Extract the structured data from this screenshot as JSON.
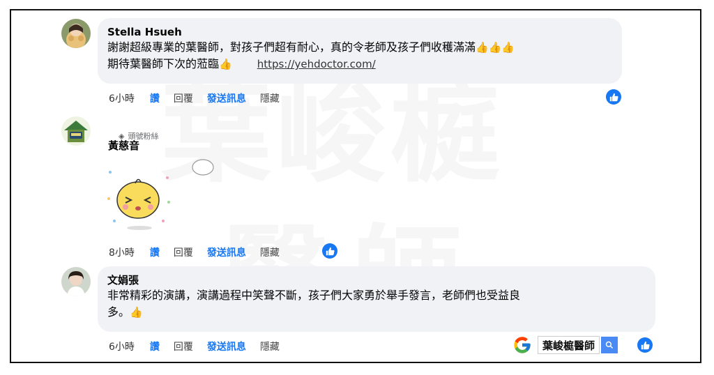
{
  "watermark": {
    "line1": "葉峻榳",
    "line2": "醫師"
  },
  "comments": [
    {
      "author": "Stella Hsueh",
      "line1": "謝謝超級專業的葉醫師，對孩子們超有耐心，真的令老師及孩子們收穫滿滿",
      "line1_emoji": "👍👍👍",
      "line2": "期待葉醫師下次的蒞臨",
      "line2_emoji": "👍",
      "link": "https://yehdoctor.com/",
      "time": "6小時",
      "like": "讚",
      "reply": "回覆",
      "send": "發送訊息",
      "hide": "隱藏"
    },
    {
      "badge": "頭號粉絲",
      "author": "黃慈音",
      "time": "8小時",
      "like": "讚",
      "reply": "回覆",
      "send": "發送訊息",
      "hide": "隱藏"
    },
    {
      "author": "文娟張",
      "line1": "非常精彩的演講，演講過程中笑聲不斷，孩子們大家勇於舉手發言，老師們也受益良",
      "line2": "多。",
      "line2_emoji": "👍",
      "time": "6小時",
      "like": "讚",
      "reply": "回覆",
      "send": "發送訊息",
      "hide": "隱藏"
    }
  ],
  "search": {
    "query": "葉峻榳醫師"
  },
  "icons": {
    "like_badge": "thumbs-up-icon",
    "fan_badge": "diamond-icon",
    "search": "magnifier-icon",
    "google": "google-g-logo"
  },
  "colors": {
    "accent": "#1877f2",
    "bubble": "#f0f2f5"
  }
}
